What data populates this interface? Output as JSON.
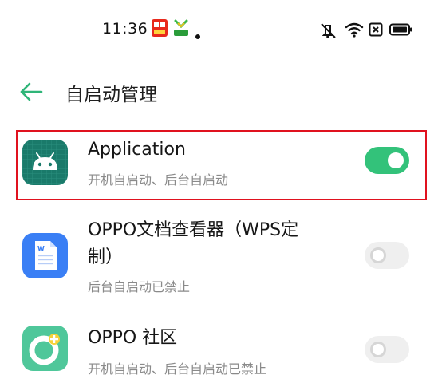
{
  "status_bar": {
    "time": "11:36",
    "icons": [
      "notification-app-icon",
      "notification-app-icon-2",
      "dot-icon",
      "mute-icon",
      "wifi-icon",
      "sim-icon",
      "battery-icon"
    ]
  },
  "header": {
    "title": "自启动管理",
    "back_icon": "back-arrow-icon"
  },
  "apps": [
    {
      "name": "Application",
      "status": "开机自启动、后台自启动",
      "enabled": true,
      "highlighted": true
    },
    {
      "name": "OPPO文档查看器（WPS定\n制）",
      "status": "后台自启动已禁止",
      "enabled": false,
      "highlighted": false
    },
    {
      "name": "OPPO 社区",
      "status": "开机自启动、后台自启动已禁止",
      "enabled": false,
      "highlighted": false
    }
  ],
  "colors": {
    "accent": "#33c27a",
    "highlight_border": "#e0121f",
    "android_icon_bg": "#1a7a6a",
    "wps_icon_bg": "#3a7ff5",
    "community_icon_bg": "#4fc79a"
  }
}
